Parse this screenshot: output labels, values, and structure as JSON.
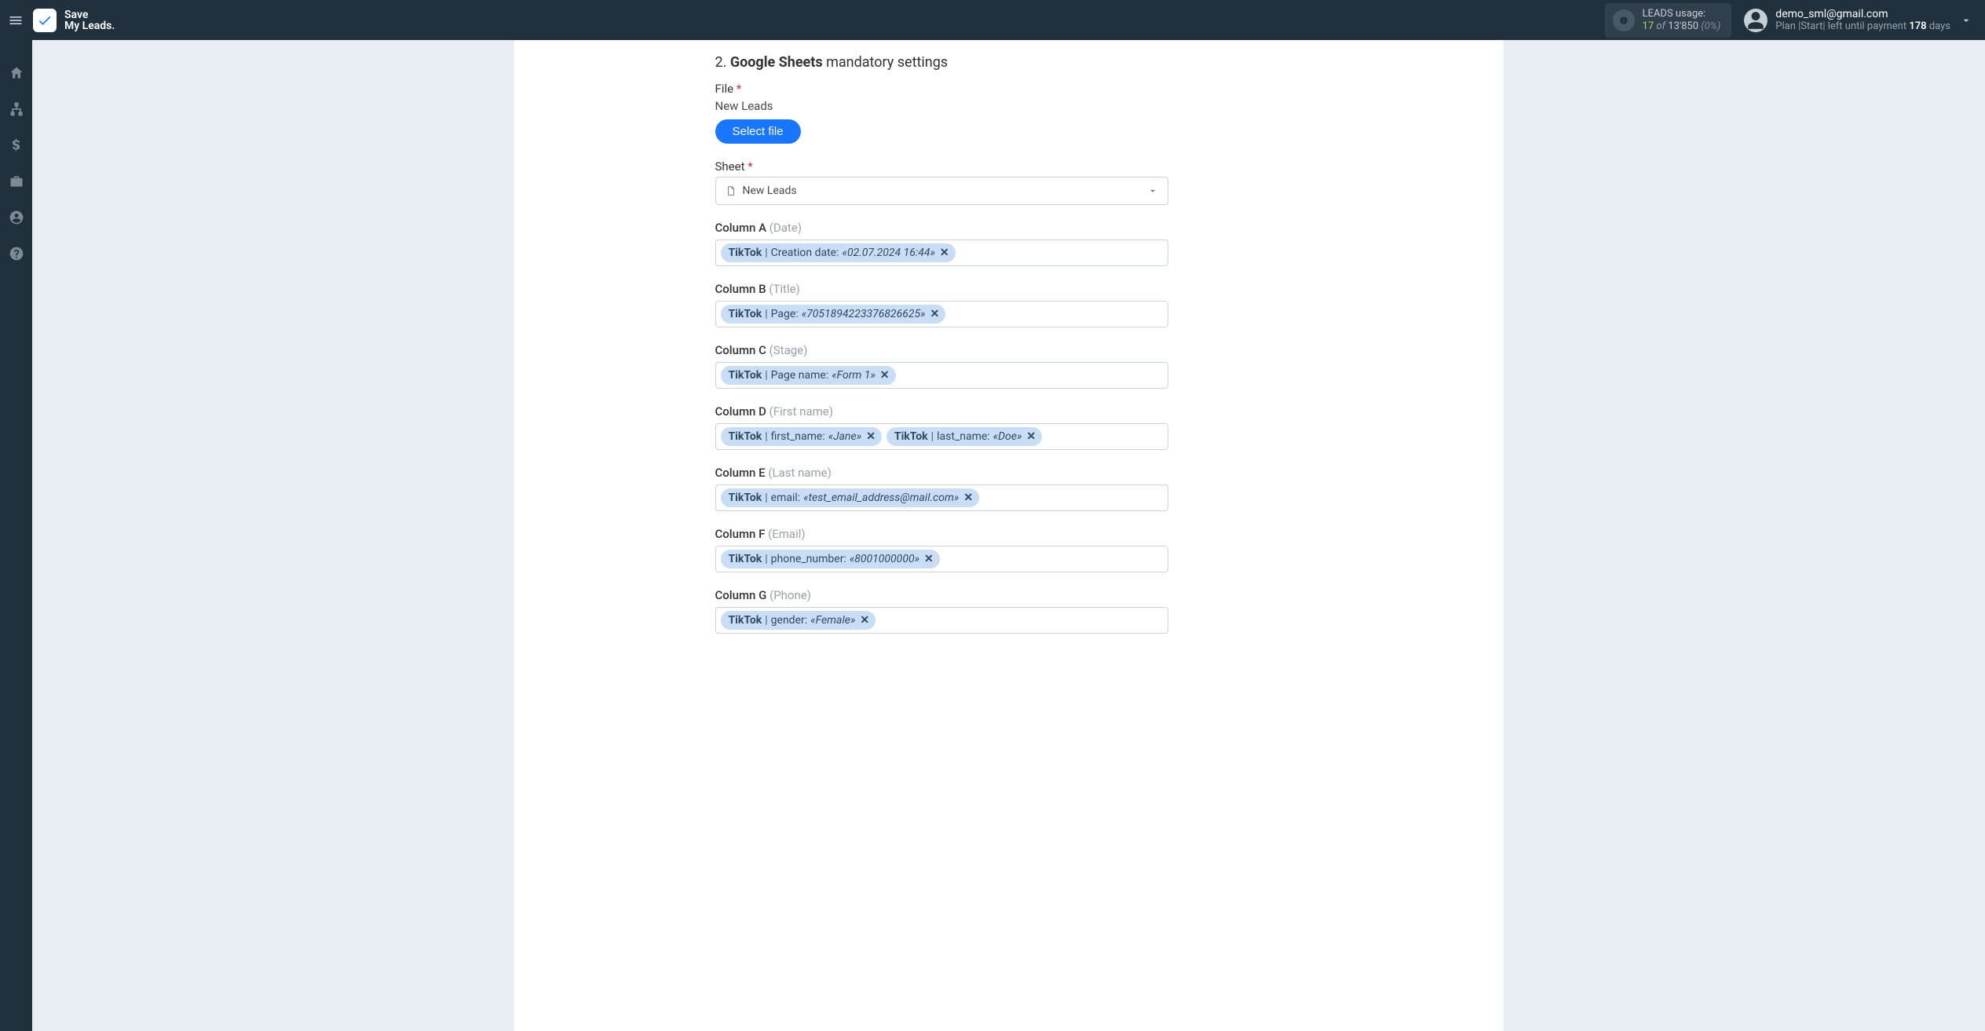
{
  "brand": {
    "line1": "Save",
    "line2": "My Leads."
  },
  "usage": {
    "label": "LEADS usage:",
    "used": "17",
    "of": "of",
    "total": "13'850",
    "pct": "(0%)"
  },
  "user": {
    "email": "demo_sml@gmail.com",
    "plan_prefix": "Plan |Start| left until payment",
    "days": "178",
    "days_suffix": "days"
  },
  "section": {
    "num": "2.",
    "bold": "Google Sheets",
    "rest": "mandatory settings"
  },
  "file": {
    "label": "File",
    "value": "New Leads",
    "button": "Select file"
  },
  "sheet": {
    "label": "Sheet",
    "value": "New Leads"
  },
  "columns": [
    {
      "label": "Column A",
      "hint": "(Date)",
      "tags": [
        {
          "src": "TikTok",
          "field": "Creation date:",
          "val": "«02.07.2024 16:44»"
        }
      ]
    },
    {
      "label": "Column B",
      "hint": "(Title)",
      "tags": [
        {
          "src": "TikTok",
          "field": "Page:",
          "val": "«7051894223376826625»"
        }
      ]
    },
    {
      "label": "Column C",
      "hint": "(Stage)",
      "tags": [
        {
          "src": "TikTok",
          "field": "Page name:",
          "val": "«Form 1»"
        }
      ]
    },
    {
      "label": "Column D",
      "hint": "(First name)",
      "tags": [
        {
          "src": "TikTok",
          "field": "first_name:",
          "val": "«Jane»"
        },
        {
          "src": "TikTok",
          "field": "last_name:",
          "val": "«Doe»"
        }
      ]
    },
    {
      "label": "Column E",
      "hint": "(Last name)",
      "tags": [
        {
          "src": "TikTok",
          "field": "email:",
          "val": "«test_email_address@mail.com»"
        }
      ]
    },
    {
      "label": "Column F",
      "hint": "(Email)",
      "tags": [
        {
          "src": "TikTok",
          "field": "phone_number:",
          "val": "«8001000000»"
        }
      ]
    },
    {
      "label": "Column G",
      "hint": "(Phone)",
      "tags": [
        {
          "src": "TikTok",
          "field": "gender:",
          "val": "«Female»"
        }
      ]
    }
  ]
}
